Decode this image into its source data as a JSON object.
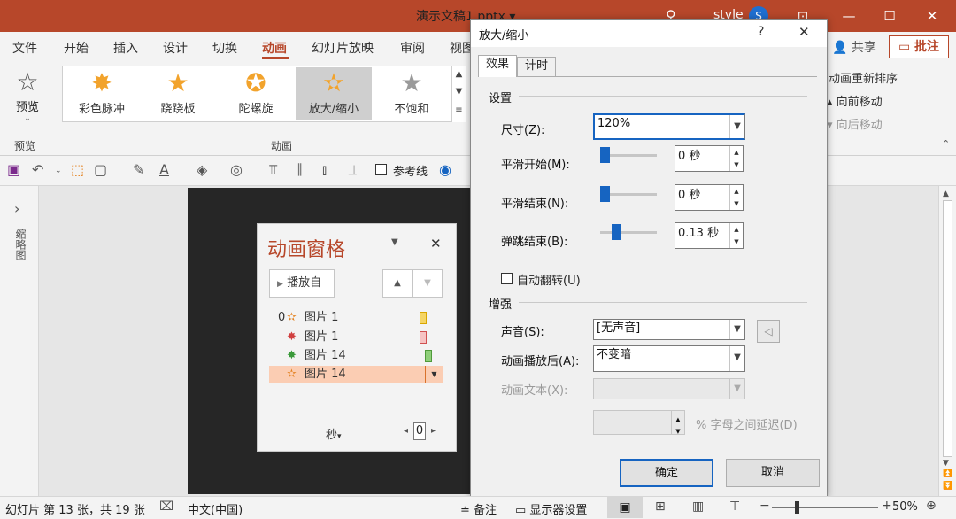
{
  "app": {
    "title": "演示文稿1.pptx ▾",
    "user_label": "style",
    "avatar": "S",
    "share": "共享",
    "comment": "批注"
  },
  "ribbon_tabs": [
    "文件",
    "开始",
    "插入",
    "设计",
    "切换",
    "动画",
    "幻灯片放映",
    "审阅",
    "视图"
  ],
  "ribbon": {
    "preview_label": "预览",
    "preview_group": "预览",
    "animation_group": "动画",
    "gallery": [
      {
        "label": "彩色脉冲",
        "icon": "starburst-icon"
      },
      {
        "label": "跷跷板",
        "icon": "star-icon"
      },
      {
        "label": "陀螺旋",
        "icon": "spin-star-icon"
      },
      {
        "label": "放大/缩小",
        "icon": "grow-shrink-icon",
        "selected": true
      },
      {
        "label": "不饱和",
        "icon": "desaturate-star-icon"
      }
    ],
    "reorder": {
      "title": "动画重新排序",
      "forward": "向前移动",
      "backward": "向后移动"
    }
  },
  "qat": {
    "reference_line": "参考线"
  },
  "left_pane": {
    "label": "缩略图",
    "expand": "›"
  },
  "anim_pane": {
    "title": "动画窗格",
    "play_button": "播放自",
    "items": [
      {
        "prefix": "0",
        "label": "图片 1",
        "color": "#f5d565",
        "border": "#d9a600"
      },
      {
        "prefix": "",
        "label": "图片 1",
        "color": "#f6c3c3",
        "border": "#d05050"
      },
      {
        "prefix": "",
        "label": "图片 14",
        "color": "#8fcf7a",
        "border": "#4f9a3a"
      },
      {
        "prefix": "",
        "label": "图片 14",
        "color": "#f7b98c",
        "border": "#d9722b",
        "selected": true
      }
    ],
    "seconds_label": "秒",
    "timeline_value": "0"
  },
  "dialog": {
    "title": "放大/缩小",
    "help": "?",
    "close": "✕",
    "tabs": [
      "效果",
      "计时"
    ],
    "settings_section": "设置",
    "size_label": "尺寸(Z):",
    "size_value": "120%",
    "smooth_start_label": "平滑开始(M):",
    "smooth_start_value": "0 秒",
    "smooth_start_level": 0.0,
    "smooth_end_label": "平滑结束(N):",
    "smooth_end_value": "0 秒",
    "smooth_end_level": 0.0,
    "bounce_end_label": "弹跳结束(B):",
    "bounce_end_value": "0.13 秒",
    "bounce_end_level": 0.26,
    "auto_reverse_label": "自动翻转(U)",
    "enhance_section": "增强",
    "sound_label": "声音(S):",
    "sound_value": "[无声音]",
    "after_anim_label": "动画播放后(A):",
    "after_anim_value": "不变暗",
    "anim_text_label": "动画文本(X):",
    "delay_suffix": "% 字母之间延迟(D)",
    "ok": "确定",
    "cancel": "取消"
  },
  "status": {
    "slide_info": "幻灯片 第 13 张，共 19 张",
    "language": "中文(中国)",
    "notes": "备注",
    "display_settings": "显示器设置",
    "zoom": "50%"
  },
  "colors": {
    "accent": "#b7472a",
    "dialog_primary": "#1664c1"
  }
}
